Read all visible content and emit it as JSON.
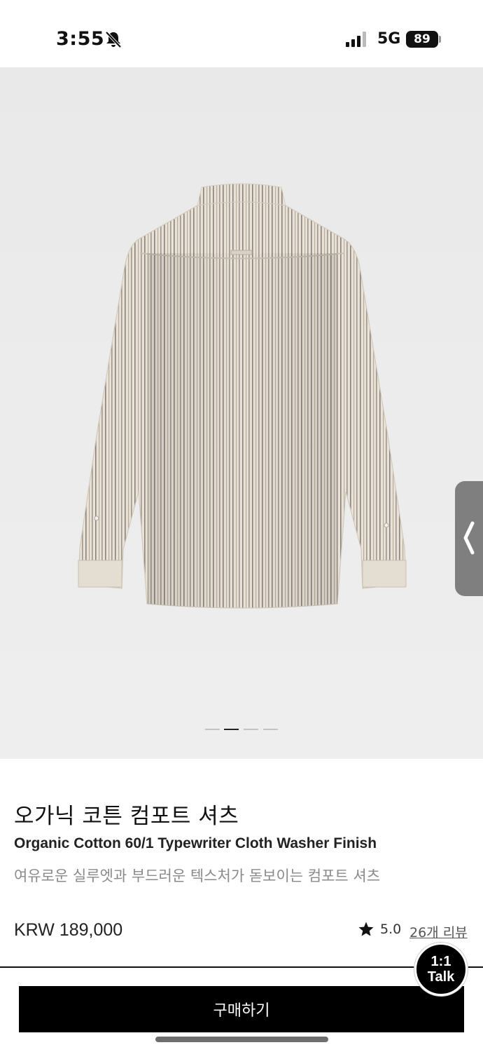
{
  "status_bar": {
    "time": "3:55",
    "network": "5G",
    "battery": "89",
    "icons": [
      "bell-slash-icon",
      "signal-bars-icon",
      "battery-icon"
    ]
  },
  "product_image": {
    "description_icon": "striped-shirt-back-view",
    "pager": {
      "count": 4,
      "active_index": 1
    },
    "side_tab_icon": "chevron-left-icon"
  },
  "product": {
    "title_ko": "오가닉 코튼 컴포트 셔츠",
    "title_en": "Organic Cotton 60/1 Typewriter Cloth Washer Finish",
    "subtitle": "여유로운 실루엣과 부드러운 텍스처가 돋보이는 컴포트 셔츠",
    "price": "KRW 189,000",
    "rating": "5.0",
    "reviews": "26개 리뷰"
  },
  "actions": {
    "buy_label": "구매하기",
    "talk_line1": "1:1",
    "talk_line2": "Talk"
  },
  "colors": {
    "accent": "#000000",
    "hero_bg": "#ebebeb",
    "subtitle_text": "#8a8a8a"
  }
}
